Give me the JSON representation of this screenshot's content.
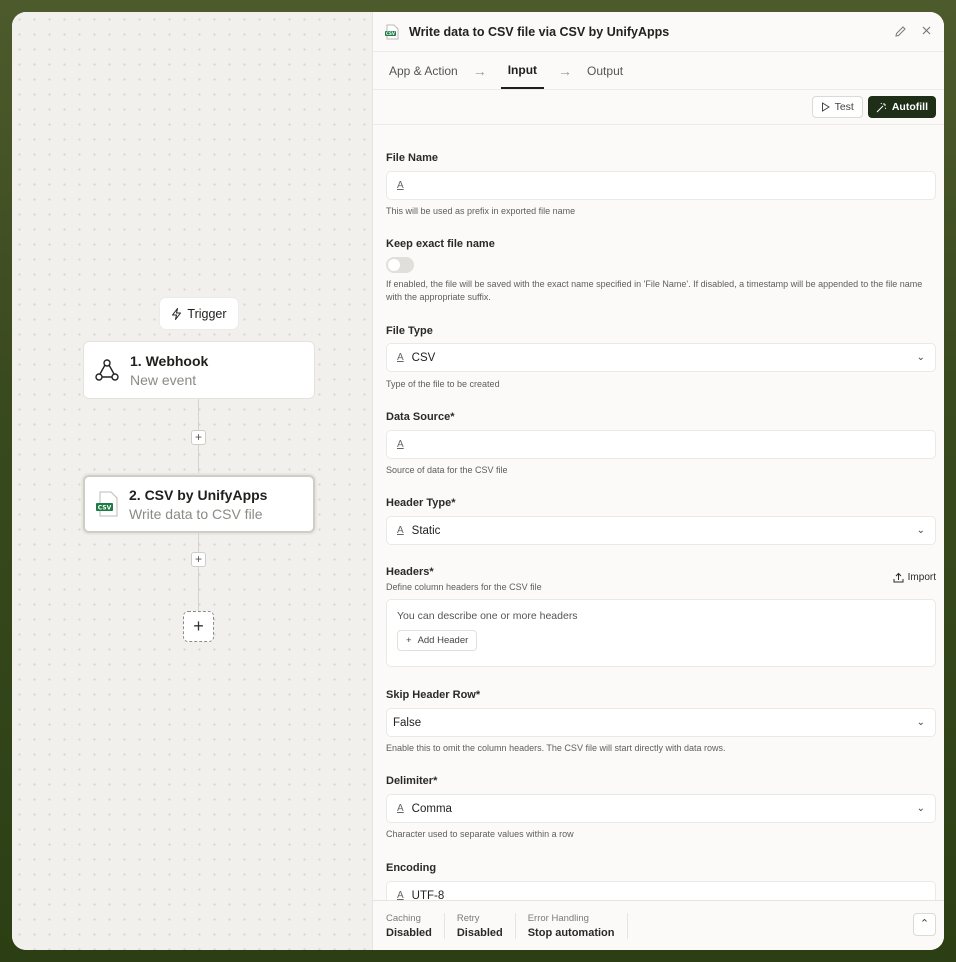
{
  "canvas": {
    "trigger_label": "Trigger",
    "nodes": [
      {
        "title": "1. Webhook",
        "subtitle": "New event"
      },
      {
        "title": "2. CSV by UnifyApps",
        "subtitle": "Write data to CSV file",
        "badge": "CSV"
      }
    ],
    "plus": "+"
  },
  "panel": {
    "title": "Write data to CSV file via CSV by UnifyApps",
    "badge": "CSV",
    "tabs": [
      {
        "label": "App & Action"
      },
      {
        "label": "Input"
      },
      {
        "label": "Output"
      }
    ],
    "test_label": "Test",
    "autofill_label": "Autofill"
  },
  "form": {
    "file_name": {
      "label": "File Name",
      "value": "",
      "help": "This will be used as prefix in exported file name"
    },
    "keep_exact": {
      "label": "Keep exact file name",
      "enabled": false,
      "help": "If enabled, the file will be saved with the exact name specified in 'File Name'. If disabled, a timestamp will be appended to the file name with the appropriate suffix."
    },
    "file_type": {
      "label": "File Type",
      "value": "CSV",
      "help": "Type of the file to be created"
    },
    "data_source": {
      "label": "Data Source*",
      "value": "",
      "help": "Source of data for the CSV file"
    },
    "header_type": {
      "label": "Header Type*",
      "value": "Static"
    },
    "headers": {
      "label": "Headers*",
      "help": "Define column headers for the CSV file",
      "import_label": "Import",
      "hint": "You can describe one or more headers",
      "add_label": "Add Header"
    },
    "skip_header": {
      "label": "Skip Header Row*",
      "value": "False",
      "help": "Enable this to omit the column headers. The CSV file will start directly with data rows."
    },
    "delimiter": {
      "label": "Delimiter*",
      "value": "Comma",
      "help": "Character used to separate values within a row"
    },
    "encoding": {
      "label": "Encoding",
      "value": "UTF-8"
    }
  },
  "footer": {
    "items": [
      {
        "label": "Caching",
        "value": "Disabled"
      },
      {
        "label": "Retry",
        "value": "Disabled"
      },
      {
        "label": "Error Handling",
        "value": "Stop automation"
      }
    ]
  },
  "colors": {
    "accent": "#1f2e17",
    "csv_green": "#1e7b45",
    "frame": "#3a4a1f"
  }
}
